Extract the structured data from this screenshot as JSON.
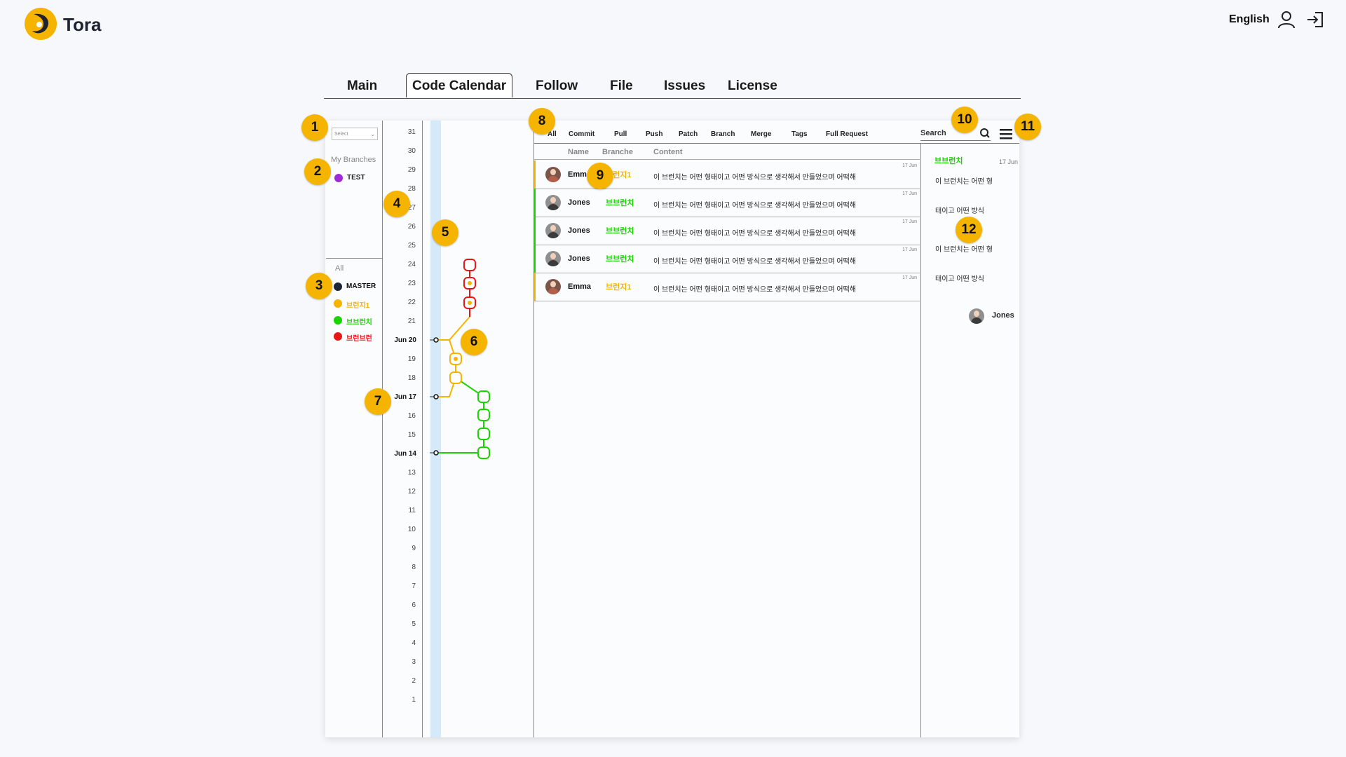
{
  "app": {
    "name": "Tora",
    "language": "English"
  },
  "header_icons": [
    "user-icon",
    "logout-icon"
  ],
  "tabs": [
    {
      "label": "Main",
      "active": false
    },
    {
      "label": "Code Calendar",
      "active": true
    },
    {
      "label": "Follow",
      "active": false
    },
    {
      "label": "File",
      "active": false
    },
    {
      "label": "Issues",
      "active": false
    },
    {
      "label": "License",
      "active": false
    }
  ],
  "sidebar": {
    "select_placeholder": "Select",
    "my_branches_label": "My Branches",
    "my_branches": [
      {
        "label": "TEST",
        "color": "#a02bd6"
      }
    ],
    "all_label": "All",
    "all_branches": [
      {
        "label": "MASTER",
        "color": "#1e2536"
      },
      {
        "label": "브런지1",
        "color": "#f5b400"
      },
      {
        "label": "브브런치",
        "color": "#19d400"
      },
      {
        "label": "브런브런",
        "color": "#e81717"
      }
    ]
  },
  "calendar": {
    "days": [
      "31",
      "30",
      "29",
      "28",
      "27",
      "26",
      "25",
      "24",
      "23",
      "22",
      "21",
      "20",
      "19",
      "18",
      "17",
      "16",
      "15",
      "14",
      "13",
      "12",
      "11",
      "10",
      "9",
      "8",
      "7",
      "6",
      "5",
      "4",
      "3",
      "2",
      "1"
    ],
    "month_marks": {
      "20": "Jun",
      "17": "Jun",
      "14": "Jun"
    }
  },
  "filters": [
    "All",
    "Commit",
    "Pull",
    "Push",
    "Patch",
    "Branch",
    "Merge",
    "Tags",
    "Full Request"
  ],
  "search": {
    "label": "Search"
  },
  "table": {
    "columns": [
      "Name",
      "Branche",
      "Content"
    ],
    "rows": [
      {
        "name": "Emma",
        "branch": "브런지1",
        "branch_color": "#f5b400",
        "content": "이 브런치는 어떤 형태이고 어떤 방식으로 생각해서 만들었으며 어떡해",
        "date": "17 Jun",
        "gender": "f"
      },
      {
        "name": "Jones",
        "branch": "브브런치",
        "branch_color": "#19d400",
        "content": "이 브런치는 어떤 형태이고 어떤 방식으로 생각해서 만들었으며 어떡해",
        "date": "17 Jun",
        "gender": "m"
      },
      {
        "name": "Jones",
        "branch": "브브런치",
        "branch_color": "#19d400",
        "content": "이 브런치는 어떤 형태이고 어떤 방식으로 생각해서 만들었으며 어떡해",
        "date": "17 Jun",
        "gender": "m"
      },
      {
        "name": "Jones",
        "branch": "브브런치",
        "branch_color": "#19d400",
        "content": "이 브런치는 어떤 형태이고 어떤 방식으로 생각해서 만들었으며 어떡해",
        "date": "17 Jun",
        "gender": "m"
      },
      {
        "name": "Emma",
        "branch": "브런지1",
        "branch_color": "#f5b400",
        "content": "이 브런치는 어떤 형태이고 어떤 방식으로 생각해서 만들었으며 어떡해",
        "date": "17 Jun",
        "gender": "f"
      }
    ]
  },
  "detail": {
    "branch": "브브런치",
    "branch_color": "#19d400",
    "date": "17 Jun",
    "lines": [
      "이 브런치는 어떤 형",
      "태이고 어떤 방식",
      "이 브런치는 어떤 형",
      "태이고 어떤 방식"
    ],
    "author": "Jones"
  },
  "badges": [
    "1",
    "2",
    "3",
    "4",
    "5",
    "6",
    "7",
    "8",
    "9",
    "10",
    "11",
    "12"
  ]
}
